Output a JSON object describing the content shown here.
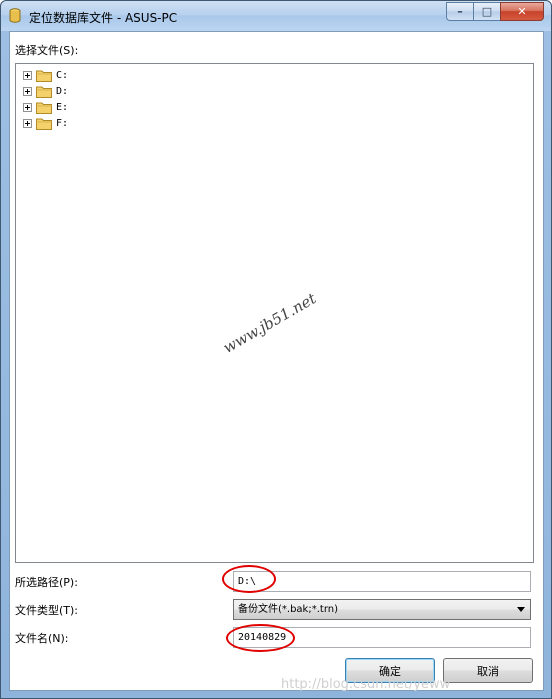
{
  "window": {
    "title": "定位数据库文件 - ASUS-PC",
    "minimize_symbol": "–",
    "maximize_symbol": "□",
    "close_symbol": "✕"
  },
  "file_select": {
    "label": "选择文件(S):",
    "drives": [
      {
        "label": "C:"
      },
      {
        "label": "D:"
      },
      {
        "label": "E:"
      },
      {
        "label": "F:"
      }
    ]
  },
  "selected_path": {
    "label": "所选路径(P):",
    "value": "D:\\"
  },
  "file_type": {
    "label": "文件类型(T):",
    "selected": "备份文件(*.bak;*.trn)"
  },
  "file_name": {
    "label": "文件名(N):",
    "value": "20140829"
  },
  "buttons": {
    "ok": "确定",
    "cancel": "取消"
  },
  "watermark": "www.jb51.net",
  "bottom_watermark": "http://blog.csdn.net/yeww",
  "colors": {
    "highlight_circle": "#e00000",
    "title_gradient": "#b7d1ee"
  }
}
